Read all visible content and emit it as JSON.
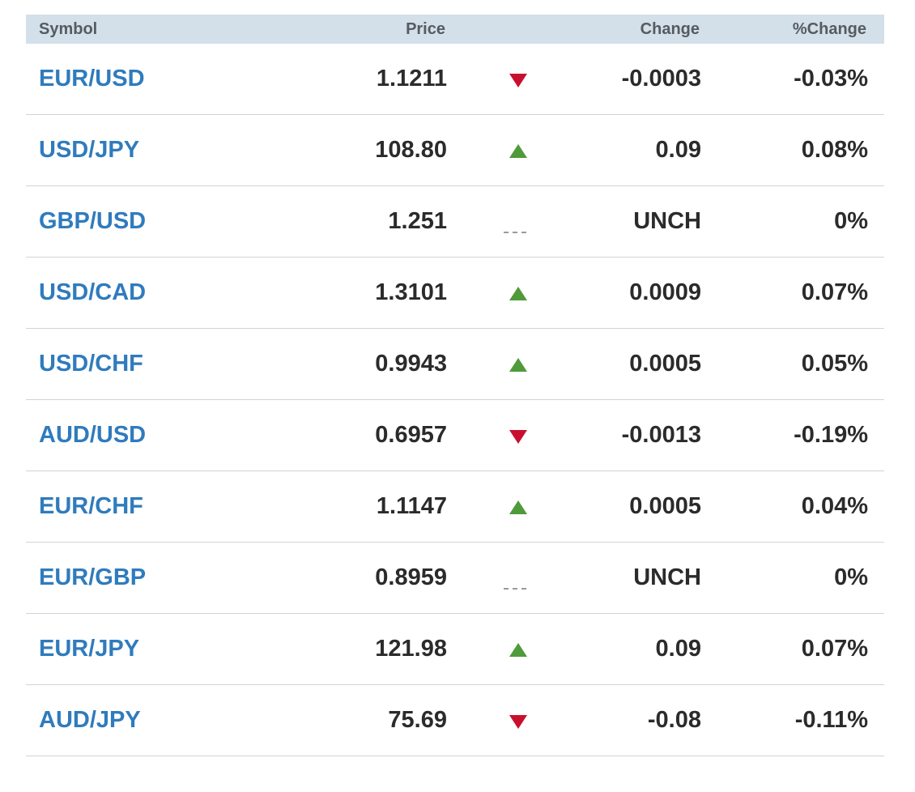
{
  "header": {
    "symbol": "Symbol",
    "price": "Price",
    "change": "Change",
    "pct_change": "%Change"
  },
  "colors": {
    "symbol_link": "#2f7bbd",
    "header_bg": "#d3e0ea",
    "down": "#c8102e",
    "up": "#4f9a3a"
  },
  "rows": [
    {
      "symbol": "EUR/USD",
      "price": "1.1211",
      "direction": "down",
      "change": "-0.0003",
      "pct": "-0.03%"
    },
    {
      "symbol": "USD/JPY",
      "price": "108.80",
      "direction": "up",
      "change": "0.09",
      "pct": "0.08%"
    },
    {
      "symbol": "GBP/USD",
      "price": "1.251",
      "direction": "flat",
      "change": "UNCH",
      "pct": "0%"
    },
    {
      "symbol": "USD/CAD",
      "price": "1.3101",
      "direction": "up",
      "change": "0.0009",
      "pct": "0.07%"
    },
    {
      "symbol": "USD/CHF",
      "price": "0.9943",
      "direction": "up",
      "change": "0.0005",
      "pct": "0.05%"
    },
    {
      "symbol": "AUD/USD",
      "price": "0.6957",
      "direction": "down",
      "change": "-0.0013",
      "pct": "-0.19%"
    },
    {
      "symbol": "EUR/CHF",
      "price": "1.1147",
      "direction": "up",
      "change": "0.0005",
      "pct": "0.04%"
    },
    {
      "symbol": "EUR/GBP",
      "price": "0.8959",
      "direction": "flat",
      "change": "UNCH",
      "pct": "0%"
    },
    {
      "symbol": "EUR/JPY",
      "price": "121.98",
      "direction": "up",
      "change": "0.09",
      "pct": "0.07%"
    },
    {
      "symbol": "AUD/JPY",
      "price": "75.69",
      "direction": "down",
      "change": "-0.08",
      "pct": "-0.11%"
    }
  ]
}
